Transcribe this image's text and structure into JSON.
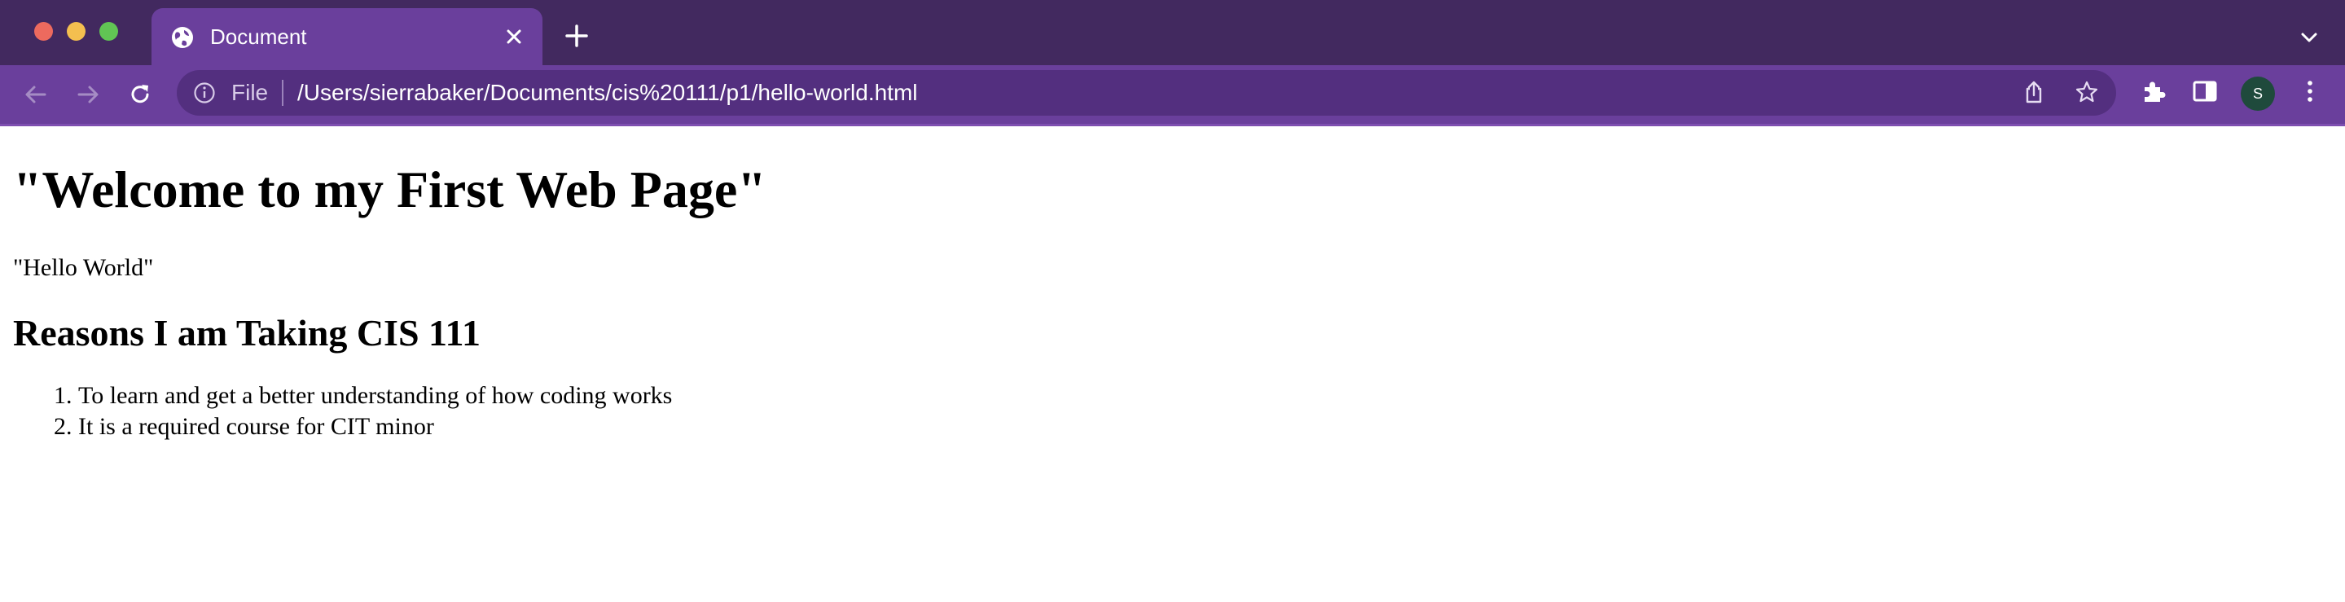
{
  "browser": {
    "tab": {
      "title": "Document"
    },
    "address_bar": {
      "scheme_label": "File",
      "url": "/Users/sierrabaker/Documents/cis%20111/p1/hello-world.html"
    },
    "profile_initial": "S"
  },
  "page": {
    "heading": "\"Welcome to my First Web Page\"",
    "paragraph": "\"Hello World\"",
    "subheading": "Reasons I am Taking CIS 111",
    "reasons": [
      "To learn and get a better understanding of how coding works",
      "It is a required course for CIT minor"
    ]
  }
}
